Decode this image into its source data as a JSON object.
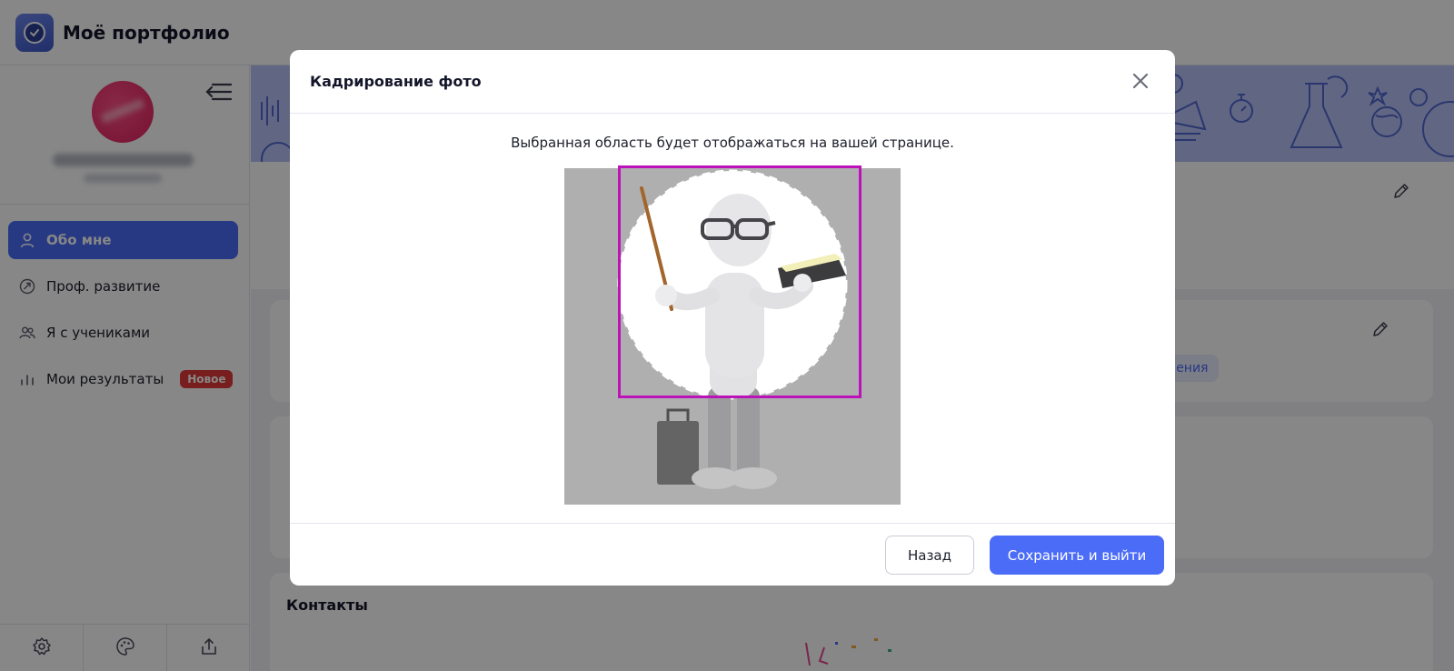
{
  "app": {
    "title": "Моё портфолио"
  },
  "sidebar": {
    "items": [
      {
        "label": "Обо мне",
        "icon": "user-icon",
        "active": true
      },
      {
        "label": "Проф. развитие",
        "icon": "growth-icon"
      },
      {
        "label": "Я с учениками",
        "icon": "users-icon"
      },
      {
        "label": "Мои результаты",
        "icon": "chart-icon",
        "badge": "Новое"
      }
    ],
    "tools": [
      "gear-icon",
      "palette-icon",
      "share-icon"
    ]
  },
  "main": {
    "chip_label": "бучения",
    "contacts_title": "Контакты"
  },
  "modal": {
    "title": "Кадрирование фото",
    "hint": "Выбранная область будет отображаться на вашей странице.",
    "back_label": "Назад",
    "save_label": "Сохранить и выйти",
    "crop_color": "#bd12ba"
  },
  "colors": {
    "accent": "#4b6cf7",
    "badge": "#e33a3a"
  }
}
